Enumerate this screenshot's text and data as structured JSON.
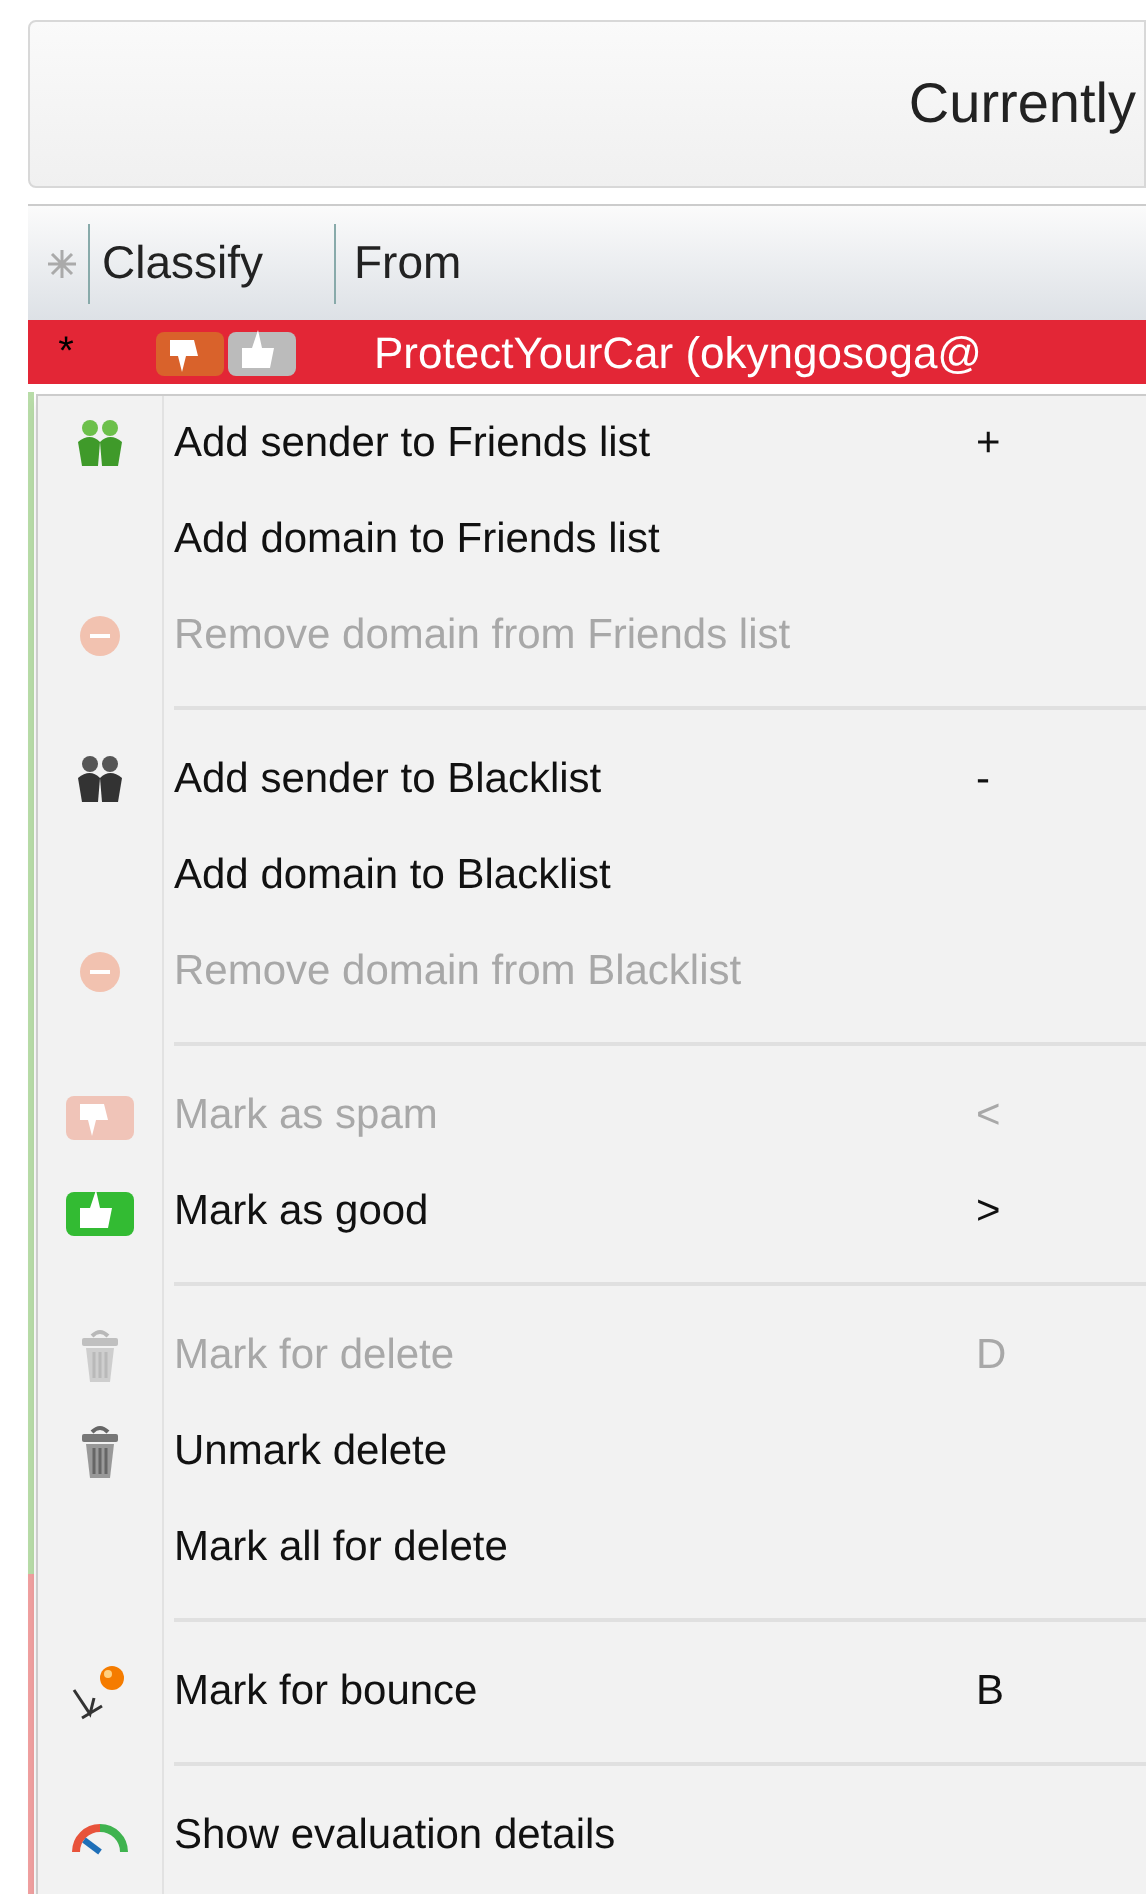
{
  "panel": {
    "status_text": "Currently"
  },
  "table": {
    "columns": [
      {
        "label": "Classify"
      },
      {
        "label": "From"
      }
    ],
    "rows": [
      {
        "marker": "*",
        "from": "ProtectYourCar (okyngosoga@",
        "selected": true
      }
    ]
  },
  "context_menu": {
    "items": [
      {
        "kind": "item",
        "label": "Add sender to Friends list",
        "shortcut": "+",
        "disabled": false
      },
      {
        "kind": "item",
        "label": "Add domain to Friends list",
        "disabled": false
      },
      {
        "kind": "item",
        "label": "Remove domain from Friends list",
        "disabled": true
      },
      {
        "kind": "separator"
      },
      {
        "kind": "item",
        "label": "Add sender to Blacklist",
        "shortcut": "-",
        "disabled": false
      },
      {
        "kind": "item",
        "label": "Add domain to Blacklist",
        "disabled": false
      },
      {
        "kind": "item",
        "label": "Remove domain from Blacklist",
        "disabled": true
      },
      {
        "kind": "separator"
      },
      {
        "kind": "item",
        "label": "Mark as spam",
        "shortcut": "<",
        "disabled": true
      },
      {
        "kind": "item",
        "label": "Mark as good",
        "shortcut": ">",
        "disabled": false
      },
      {
        "kind": "separator"
      },
      {
        "kind": "item",
        "label": "Mark for delete",
        "shortcut": "D",
        "disabled": true
      },
      {
        "kind": "item",
        "label": "Unmark delete",
        "disabled": false
      },
      {
        "kind": "item",
        "label": "Mark all for delete",
        "disabled": false
      },
      {
        "kind": "separator"
      },
      {
        "kind": "item",
        "label": "Mark for bounce",
        "shortcut": "B",
        "disabled": false
      },
      {
        "kind": "separator"
      },
      {
        "kind": "item",
        "label": "Show evaluation details",
        "disabled": false
      }
    ]
  }
}
